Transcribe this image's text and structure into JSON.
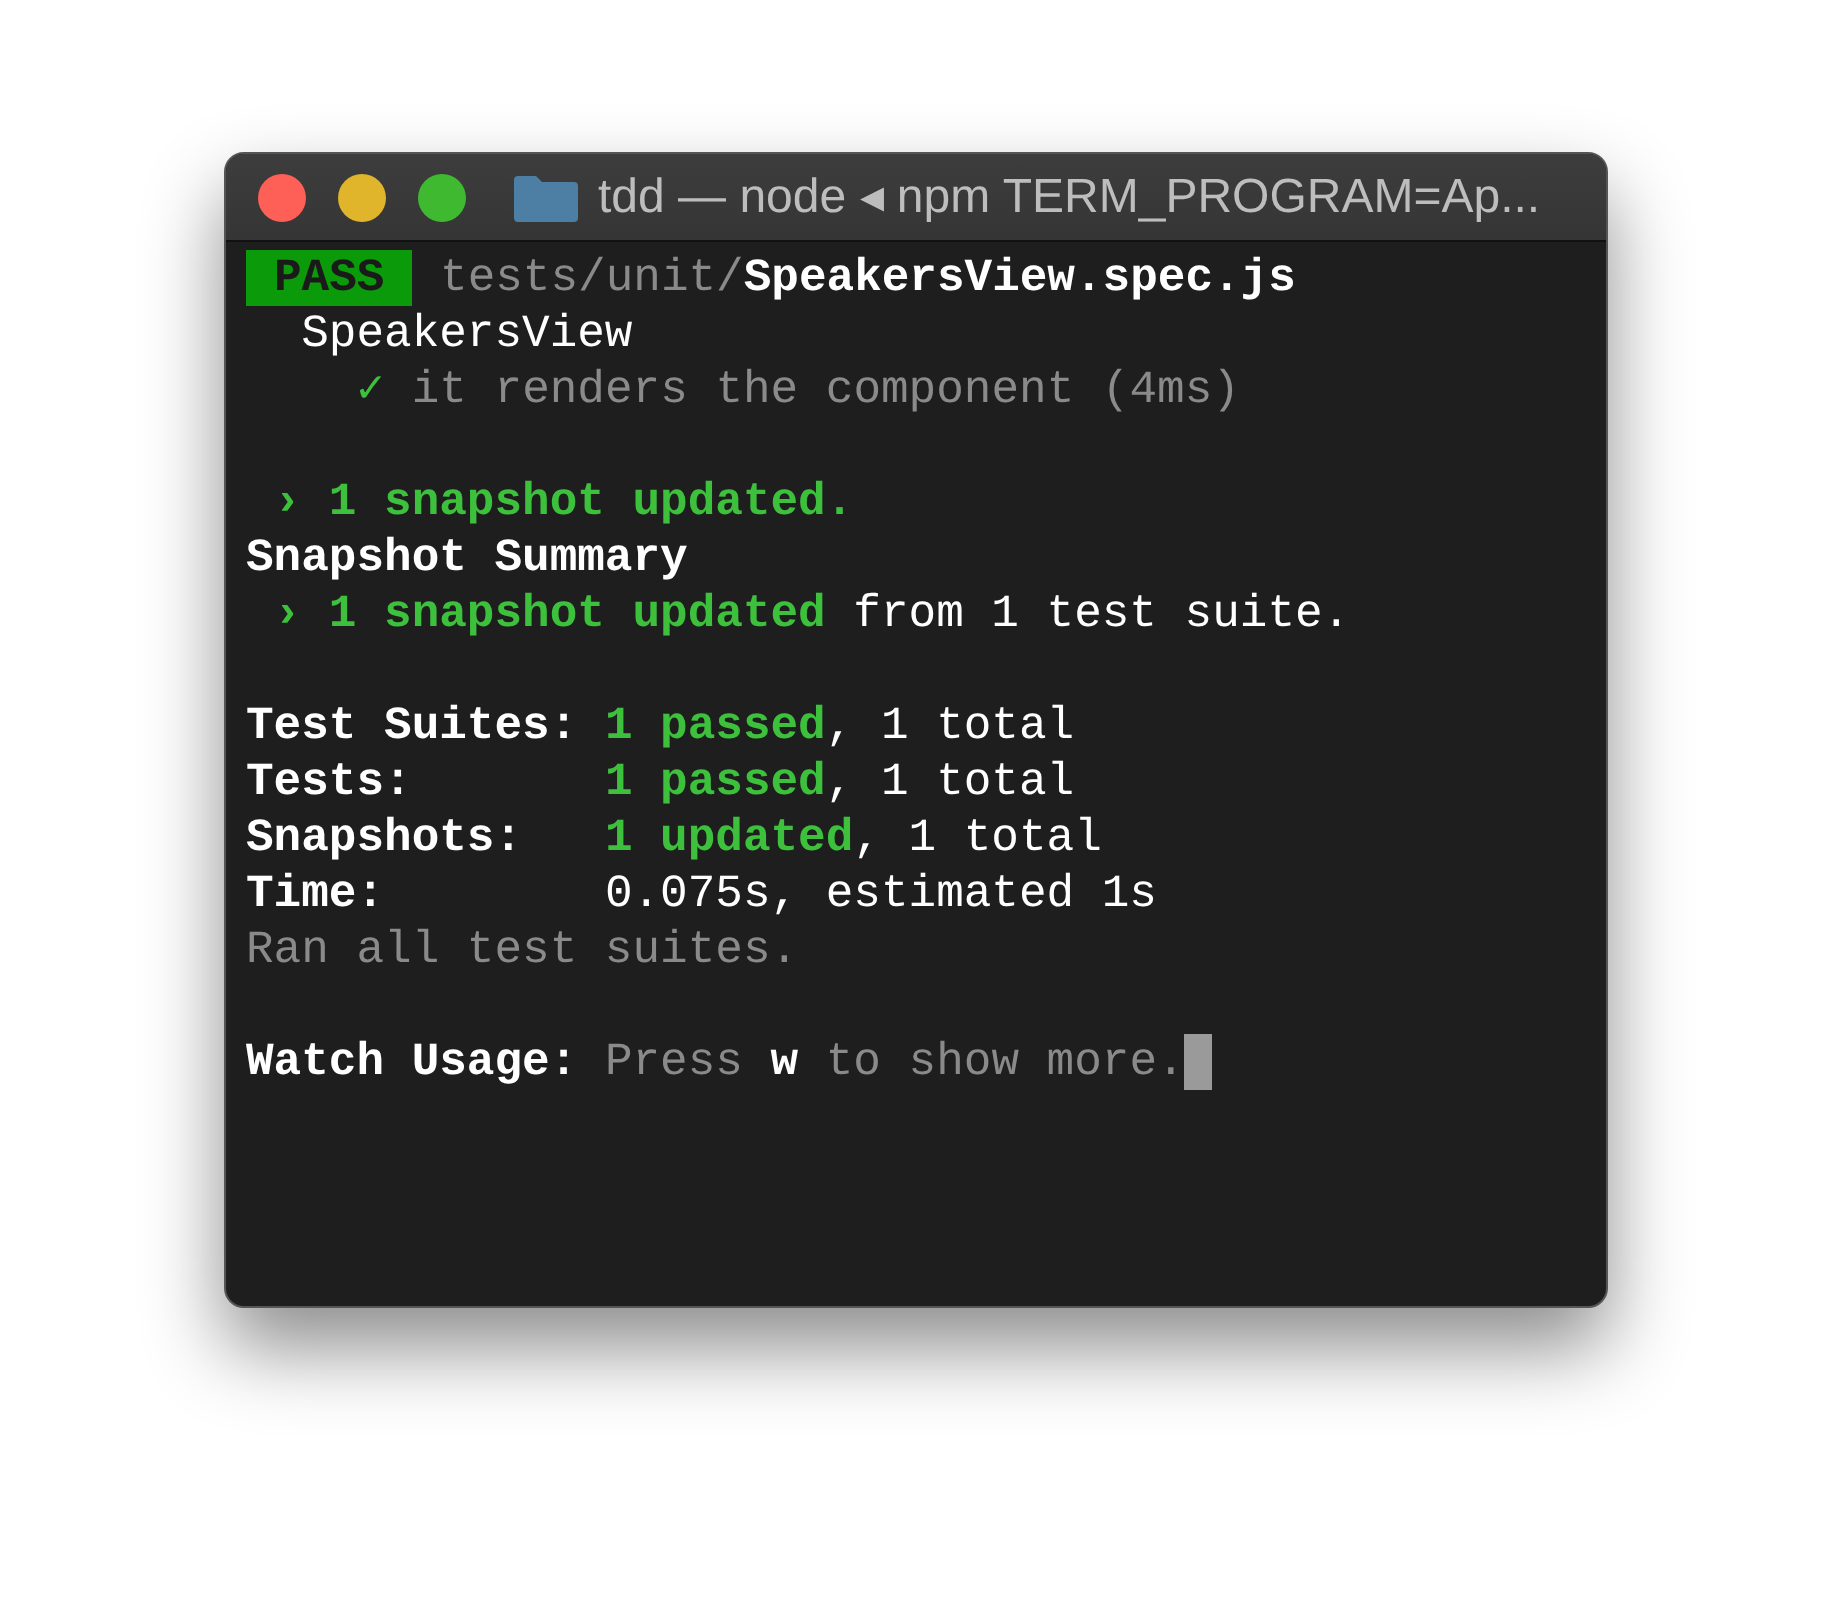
{
  "window": {
    "title": "tdd — node ◂ npm TERM_PROGRAM=Ap..."
  },
  "lines": [
    {
      "kind": "text",
      "spans": [
        {
          "kind": "badge",
          "text": "PASS"
        },
        {
          "kind": "dim",
          "text": " tests/unit/"
        },
        {
          "kind": "bold",
          "text": "SpeakersView.spec.js"
        }
      ]
    },
    {
      "kind": "text",
      "spans": [
        {
          "kind": "plain",
          "text": "  SpeakersView"
        }
      ]
    },
    {
      "kind": "text",
      "spans": [
        {
          "kind": "success",
          "text": "    ✓"
        },
        {
          "kind": "dim",
          "text": " it renders the component (4ms)"
        }
      ]
    },
    {
      "kind": "blank"
    },
    {
      "kind": "text",
      "spans": [
        {
          "kind": "success-bold",
          "text": " › 1 snapshot updated."
        }
      ]
    },
    {
      "kind": "text",
      "spans": [
        {
          "kind": "bold",
          "text": "Snapshot Summary"
        }
      ]
    },
    {
      "kind": "text",
      "spans": [
        {
          "kind": "success-bold",
          "text": " › 1 snapshot updated"
        },
        {
          "kind": "plain",
          "text": " from 1 test suite."
        }
      ]
    },
    {
      "kind": "blank"
    },
    {
      "kind": "text",
      "spans": [
        {
          "kind": "bold",
          "text": "Test Suites: "
        },
        {
          "kind": "success-bold",
          "text": "1 passed"
        },
        {
          "kind": "plain",
          "text": ", 1 total"
        }
      ]
    },
    {
      "kind": "text",
      "spans": [
        {
          "kind": "bold",
          "text": "Tests:       "
        },
        {
          "kind": "success-bold",
          "text": "1 passed"
        },
        {
          "kind": "plain",
          "text": ", 1 total"
        }
      ]
    },
    {
      "kind": "text",
      "spans": [
        {
          "kind": "bold",
          "text": "Snapshots:   "
        },
        {
          "kind": "success-bold",
          "text": "1 updated"
        },
        {
          "kind": "plain",
          "text": ", 1 total"
        }
      ]
    },
    {
      "kind": "text",
      "spans": [
        {
          "kind": "bold",
          "text": "Time:        "
        },
        {
          "kind": "plain",
          "text": "0.075s, estimated 1s"
        }
      ]
    },
    {
      "kind": "text",
      "spans": [
        {
          "kind": "dim",
          "text": "Ran all test suites."
        }
      ]
    },
    {
      "kind": "blank"
    },
    {
      "kind": "text",
      "cursor": true,
      "spans": [
        {
          "kind": "bold",
          "text": "Watch Usage: "
        },
        {
          "kind": "dim",
          "text": "Press "
        },
        {
          "kind": "bold",
          "text": "w"
        },
        {
          "kind": "dim",
          "text": " to show more."
        }
      ]
    }
  ]
}
